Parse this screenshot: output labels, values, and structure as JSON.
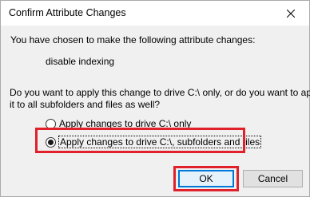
{
  "window": {
    "title": "Confirm Attribute Changes",
    "close_icon": "close-icon"
  },
  "message": {
    "intro": "You have chosen to make the following attribute changes:",
    "change": "disable indexing",
    "question_line1": "Do you want to apply this change to drive C:\\ only, or do you want to apply",
    "question_line2": "it to all subfolders and files as well?"
  },
  "options": [
    {
      "label": "Apply changes to drive C:\\ only",
      "selected": false
    },
    {
      "label": "Apply changes to drive C:\\, subfolders and files",
      "selected": true
    }
  ],
  "buttons": {
    "ok": "OK",
    "cancel": "Cancel"
  },
  "colors": {
    "highlight": "#e0202a",
    "ok_focus_border": "#0078d7",
    "dialog_background": "#f0f0f0"
  }
}
